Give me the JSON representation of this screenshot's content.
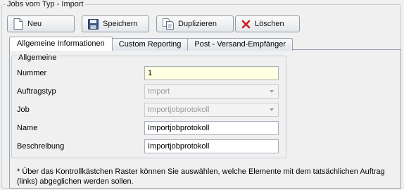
{
  "group_title": "Jobs vom Typ - Import",
  "toolbar": {
    "new_label": "Neu",
    "save_label": "Speichern",
    "duplicate_label": "Duplizieren",
    "delete_label": "Löschen"
  },
  "tabs": [
    {
      "label": "Allgemeine Informationen",
      "active": true
    },
    {
      "label": "Custom Reporting",
      "active": false
    },
    {
      "label": "Post - Versand-Empfänger",
      "active": false
    }
  ],
  "general": {
    "title": "Allgemeine",
    "number_label": "Nummer",
    "number_value": "1",
    "ordertype_label": "Auftragstyp",
    "ordertype_value": "Import",
    "job_label": "Job",
    "job_value": "Importjobprotokoll",
    "name_label": "Name",
    "name_value": "Importjobprotokoll",
    "description_label": "Beschreibung",
    "description_value": "Importjobprotokoll"
  },
  "note": "* Über das Kontrollkästchen Raster können Sie auswählen, welche Elemente mit dem tatsächlichen Auftrag (links) abgeglichen werden sollen.",
  "colors": {
    "required_field_bg": "#ffffe1",
    "delete_icon": "#c8201e"
  }
}
